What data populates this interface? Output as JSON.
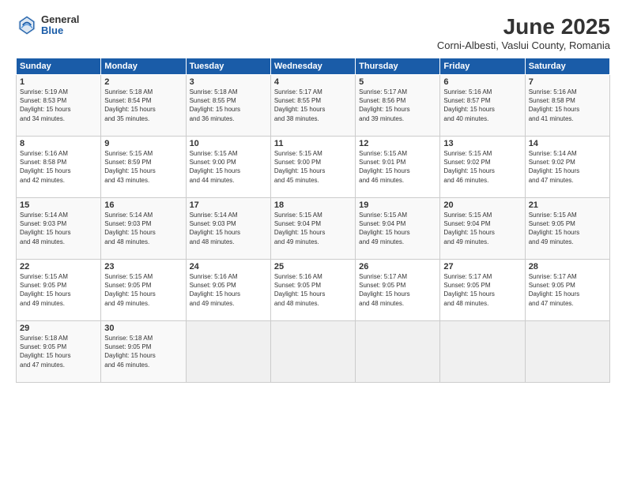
{
  "logo": {
    "general": "General",
    "blue": "Blue"
  },
  "title": "June 2025",
  "subtitle": "Corni-Albesti, Vaslui County, Romania",
  "headers": [
    "Sunday",
    "Monday",
    "Tuesday",
    "Wednesday",
    "Thursday",
    "Friday",
    "Saturday"
  ],
  "weeks": [
    [
      {
        "day": "1",
        "info": "Sunrise: 5:19 AM\nSunset: 8:53 PM\nDaylight: 15 hours\nand 34 minutes."
      },
      {
        "day": "2",
        "info": "Sunrise: 5:18 AM\nSunset: 8:54 PM\nDaylight: 15 hours\nand 35 minutes."
      },
      {
        "day": "3",
        "info": "Sunrise: 5:18 AM\nSunset: 8:55 PM\nDaylight: 15 hours\nand 36 minutes."
      },
      {
        "day": "4",
        "info": "Sunrise: 5:17 AM\nSunset: 8:55 PM\nDaylight: 15 hours\nand 38 minutes."
      },
      {
        "day": "5",
        "info": "Sunrise: 5:17 AM\nSunset: 8:56 PM\nDaylight: 15 hours\nand 39 minutes."
      },
      {
        "day": "6",
        "info": "Sunrise: 5:16 AM\nSunset: 8:57 PM\nDaylight: 15 hours\nand 40 minutes."
      },
      {
        "day": "7",
        "info": "Sunrise: 5:16 AM\nSunset: 8:58 PM\nDaylight: 15 hours\nand 41 minutes."
      }
    ],
    [
      {
        "day": "8",
        "info": "Sunrise: 5:16 AM\nSunset: 8:58 PM\nDaylight: 15 hours\nand 42 minutes."
      },
      {
        "day": "9",
        "info": "Sunrise: 5:15 AM\nSunset: 8:59 PM\nDaylight: 15 hours\nand 43 minutes."
      },
      {
        "day": "10",
        "info": "Sunrise: 5:15 AM\nSunset: 9:00 PM\nDaylight: 15 hours\nand 44 minutes."
      },
      {
        "day": "11",
        "info": "Sunrise: 5:15 AM\nSunset: 9:00 PM\nDaylight: 15 hours\nand 45 minutes."
      },
      {
        "day": "12",
        "info": "Sunrise: 5:15 AM\nSunset: 9:01 PM\nDaylight: 15 hours\nand 46 minutes."
      },
      {
        "day": "13",
        "info": "Sunrise: 5:15 AM\nSunset: 9:02 PM\nDaylight: 15 hours\nand 46 minutes."
      },
      {
        "day": "14",
        "info": "Sunrise: 5:14 AM\nSunset: 9:02 PM\nDaylight: 15 hours\nand 47 minutes."
      }
    ],
    [
      {
        "day": "15",
        "info": "Sunrise: 5:14 AM\nSunset: 9:03 PM\nDaylight: 15 hours\nand 48 minutes."
      },
      {
        "day": "16",
        "info": "Sunrise: 5:14 AM\nSunset: 9:03 PM\nDaylight: 15 hours\nand 48 minutes."
      },
      {
        "day": "17",
        "info": "Sunrise: 5:14 AM\nSunset: 9:03 PM\nDaylight: 15 hours\nand 48 minutes."
      },
      {
        "day": "18",
        "info": "Sunrise: 5:15 AM\nSunset: 9:04 PM\nDaylight: 15 hours\nand 49 minutes."
      },
      {
        "day": "19",
        "info": "Sunrise: 5:15 AM\nSunset: 9:04 PM\nDaylight: 15 hours\nand 49 minutes."
      },
      {
        "day": "20",
        "info": "Sunrise: 5:15 AM\nSunset: 9:04 PM\nDaylight: 15 hours\nand 49 minutes."
      },
      {
        "day": "21",
        "info": "Sunrise: 5:15 AM\nSunset: 9:05 PM\nDaylight: 15 hours\nand 49 minutes."
      }
    ],
    [
      {
        "day": "22",
        "info": "Sunrise: 5:15 AM\nSunset: 9:05 PM\nDaylight: 15 hours\nand 49 minutes."
      },
      {
        "day": "23",
        "info": "Sunrise: 5:15 AM\nSunset: 9:05 PM\nDaylight: 15 hours\nand 49 minutes."
      },
      {
        "day": "24",
        "info": "Sunrise: 5:16 AM\nSunset: 9:05 PM\nDaylight: 15 hours\nand 49 minutes."
      },
      {
        "day": "25",
        "info": "Sunrise: 5:16 AM\nSunset: 9:05 PM\nDaylight: 15 hours\nand 48 minutes."
      },
      {
        "day": "26",
        "info": "Sunrise: 5:17 AM\nSunset: 9:05 PM\nDaylight: 15 hours\nand 48 minutes."
      },
      {
        "day": "27",
        "info": "Sunrise: 5:17 AM\nSunset: 9:05 PM\nDaylight: 15 hours\nand 48 minutes."
      },
      {
        "day": "28",
        "info": "Sunrise: 5:17 AM\nSunset: 9:05 PM\nDaylight: 15 hours\nand 47 minutes."
      }
    ],
    [
      {
        "day": "29",
        "info": "Sunrise: 5:18 AM\nSunset: 9:05 PM\nDaylight: 15 hours\nand 47 minutes."
      },
      {
        "day": "30",
        "info": "Sunrise: 5:18 AM\nSunset: 9:05 PM\nDaylight: 15 hours\nand 46 minutes."
      },
      {
        "day": "",
        "info": ""
      },
      {
        "day": "",
        "info": ""
      },
      {
        "day": "",
        "info": ""
      },
      {
        "day": "",
        "info": ""
      },
      {
        "day": "",
        "info": ""
      }
    ]
  ]
}
